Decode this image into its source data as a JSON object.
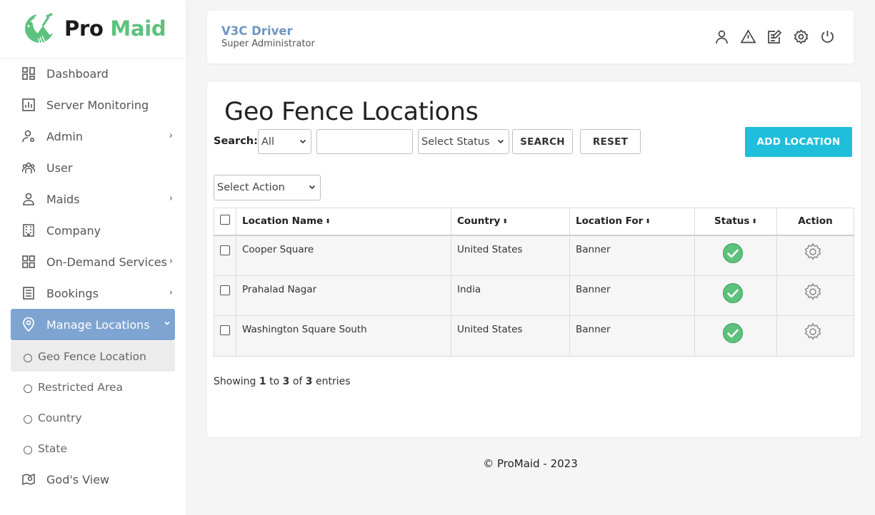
{
  "brand": {
    "pro": "Pro",
    "maid": "Maid",
    "accent": "#5cc27d"
  },
  "sidebar": {
    "items": [
      {
        "label": "Dashboard",
        "icon": "dashboard-grid-icon"
      },
      {
        "label": "Server Monitoring",
        "icon": "chart-icon"
      },
      {
        "label": "Admin",
        "icon": "admin-user-icon",
        "chevron": "›"
      },
      {
        "label": "User",
        "icon": "users-icon"
      },
      {
        "label": "Maids",
        "icon": "maid-icon",
        "chevron": "›"
      },
      {
        "label": "Company",
        "icon": "building-icon"
      },
      {
        "label": "On-Demand Services",
        "icon": "services-grid-icon",
        "chevron": "›"
      },
      {
        "label": "Bookings",
        "icon": "bookings-icon",
        "chevron": "›"
      },
      {
        "label": "Manage Locations",
        "icon": "location-pin-icon",
        "chevron": "⌄"
      }
    ],
    "subitems": [
      {
        "label": "Geo Fence Location"
      },
      {
        "label": "Restricted Area"
      },
      {
        "label": "Country"
      },
      {
        "label": "State"
      }
    ],
    "last_item": {
      "label": "God's View",
      "icon": "map-view-icon"
    },
    "active_color": "#7ea4d2"
  },
  "header": {
    "user_name": "V3C Driver",
    "user_role": "Super Administrator"
  },
  "main": {
    "title": "Geo Fence Locations",
    "search_label": "Search:",
    "search_scope": "All",
    "search_value": "",
    "status_select": "Select Status",
    "search_button": "SEARCH",
    "reset_button": "RESET",
    "add_button": "ADD LOCATION",
    "add_button_color": "#1fbedb",
    "action_select": "Select Action",
    "table": {
      "headers": [
        "Location Name",
        "Country",
        "Location For",
        "Status",
        "Action"
      ],
      "sort_icon": "⬍",
      "rows": [
        {
          "name": "Cooper Square",
          "country": "United States",
          "for": "Banner"
        },
        {
          "name": "Prahalad Nagar",
          "country": "India",
          "for": "Banner"
        },
        {
          "name": "Washington Square South",
          "country": "United States",
          "for": "Banner"
        }
      ]
    },
    "showing": {
      "prefix": "Showing",
      "from": "1",
      "to_word": "to",
      "to": "3",
      "of_word": "of",
      "total": "3",
      "suffix": "entries"
    }
  },
  "footer": {
    "text": "© ProMaid - 2023"
  }
}
